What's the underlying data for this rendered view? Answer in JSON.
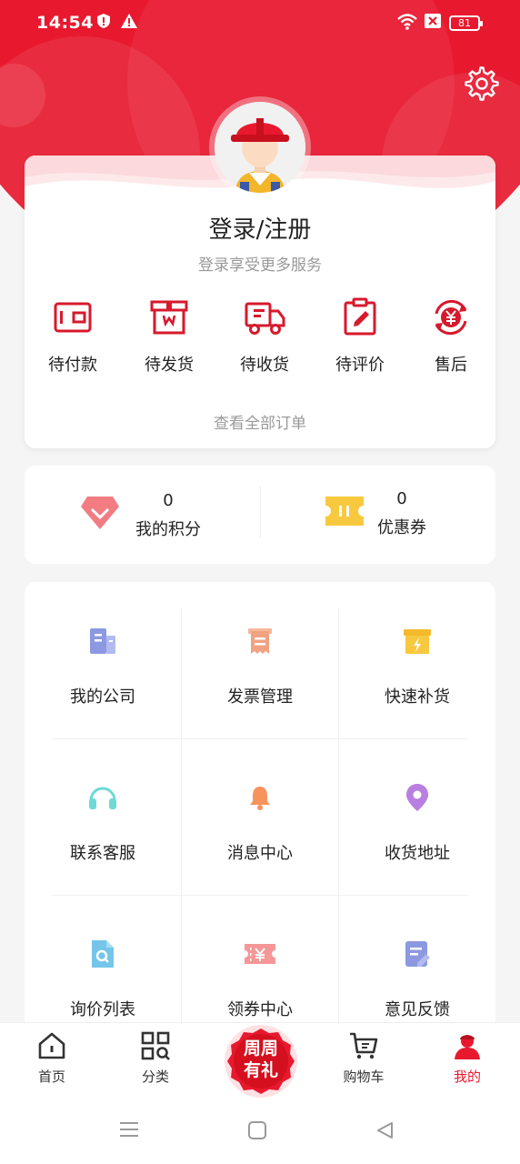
{
  "status_bar": {
    "time": "14:54",
    "battery": "81"
  },
  "profile": {
    "title": "登录/注册",
    "subtitle": "登录享受更多服务"
  },
  "orders": {
    "items": [
      {
        "label": "待付款",
        "icon": "wallet-icon"
      },
      {
        "label": "待发货",
        "icon": "package-icon"
      },
      {
        "label": "待收货",
        "icon": "truck-icon"
      },
      {
        "label": "待评价",
        "icon": "clipboard-pen-icon"
      },
      {
        "label": "售后",
        "icon": "yuan-refresh-icon"
      }
    ],
    "view_all": "查看全部订单"
  },
  "points": {
    "score_value": "0",
    "score_label": "我的积分",
    "coupon_value": "0",
    "coupon_label": "优惠券"
  },
  "services": [
    {
      "label": "我的公司",
      "icon": "building-icon"
    },
    {
      "label": "发票管理",
      "icon": "receipt-icon"
    },
    {
      "label": "快速补货",
      "icon": "box-bolt-icon"
    },
    {
      "label": "联系客服",
      "icon": "headset-icon"
    },
    {
      "label": "消息中心",
      "icon": "bell-icon"
    },
    {
      "label": "收货地址",
      "icon": "location-pin-icon"
    },
    {
      "label": "询价列表",
      "icon": "file-search-icon"
    },
    {
      "label": "领券中心",
      "icon": "coupon-yuan-icon"
    },
    {
      "label": "意见反馈",
      "icon": "feedback-edit-icon"
    }
  ],
  "tabbar": {
    "home": "首页",
    "category": "分类",
    "promo_line1": "周周",
    "promo_line2": "有礼",
    "cart": "购物车",
    "mine": "我的"
  },
  "colors": {
    "brand": "#e8192f",
    "muted": "#999999"
  }
}
